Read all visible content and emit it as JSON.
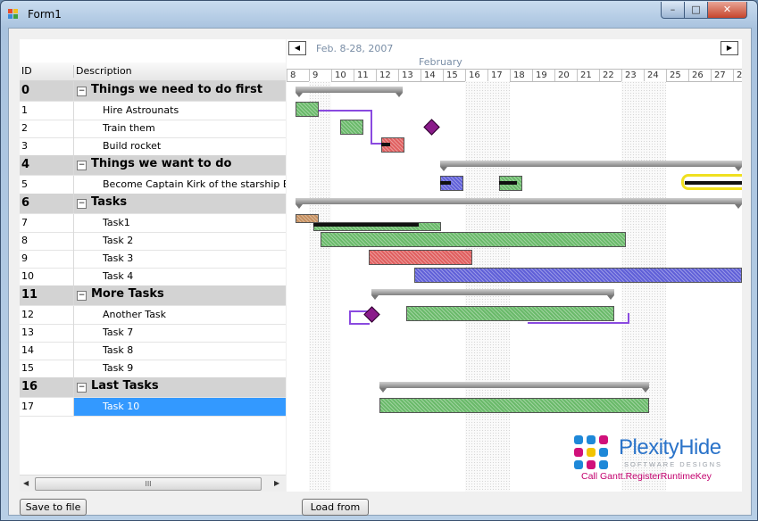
{
  "window": {
    "title": "Form1",
    "minimize": "–",
    "maximize": "□",
    "close": "✕"
  },
  "grid": {
    "columns": {
      "id": "ID",
      "description": "Description"
    },
    "rows": [
      {
        "id": "0",
        "desc": "Things we need to do first",
        "group": true
      },
      {
        "id": "1",
        "desc": "Hire Astrounats"
      },
      {
        "id": "2",
        "desc": "Train them"
      },
      {
        "id": "3",
        "desc": "Build rocket"
      },
      {
        "id": "4",
        "desc": "Things we want to do",
        "group": true
      },
      {
        "id": "5",
        "desc": "Become Captain Kirk of the starship Enter"
      },
      {
        "id": "6",
        "desc": "Tasks",
        "group": true
      },
      {
        "id": "7",
        "desc": "Task1"
      },
      {
        "id": "8",
        "desc": "Task 2"
      },
      {
        "id": "9",
        "desc": "Task 3"
      },
      {
        "id": "10",
        "desc": "Task 4"
      },
      {
        "id": "11",
        "desc": "More Tasks",
        "group": true
      },
      {
        "id": "12",
        "desc": "Another Task"
      },
      {
        "id": "13",
        "desc": "Task 7"
      },
      {
        "id": "14",
        "desc": "Task 8"
      },
      {
        "id": "15",
        "desc": "Task 9"
      },
      {
        "id": "16",
        "desc": "Last Tasks",
        "group": true
      },
      {
        "id": "17",
        "desc": "Task 10",
        "selected": true
      }
    ],
    "collapse_glyph": "−",
    "scroll_grip": "III"
  },
  "gantt": {
    "range_label": "Feb. 8-28, 2007",
    "month_label": "February",
    "days": [
      "8",
      "9",
      "10",
      "11",
      "12",
      "13",
      "14",
      "15",
      "16",
      "17",
      "18",
      "19",
      "20",
      "21",
      "22",
      "23",
      "24",
      "25",
      "26",
      "27",
      "2"
    ],
    "prev_glyph": "◀",
    "next_glyph": "▶"
  },
  "logo": {
    "name_a": "Plexity",
    "name_b": "Hide",
    "subtitle": "SOFTWARE DESIGNS",
    "key_message": "Call Gantt.RegisterRuntimeKey"
  },
  "buttons": {
    "save": "Save to file",
    "load": "Load from"
  },
  "colors": {
    "selection": "#3399ff",
    "group_row": "#d3d3d3",
    "task_green": "#6aba6a",
    "task_red": "#e06060",
    "task_blue": "#6060d8",
    "milestone": "#8a1a8a",
    "link": "#8a4ae0"
  }
}
